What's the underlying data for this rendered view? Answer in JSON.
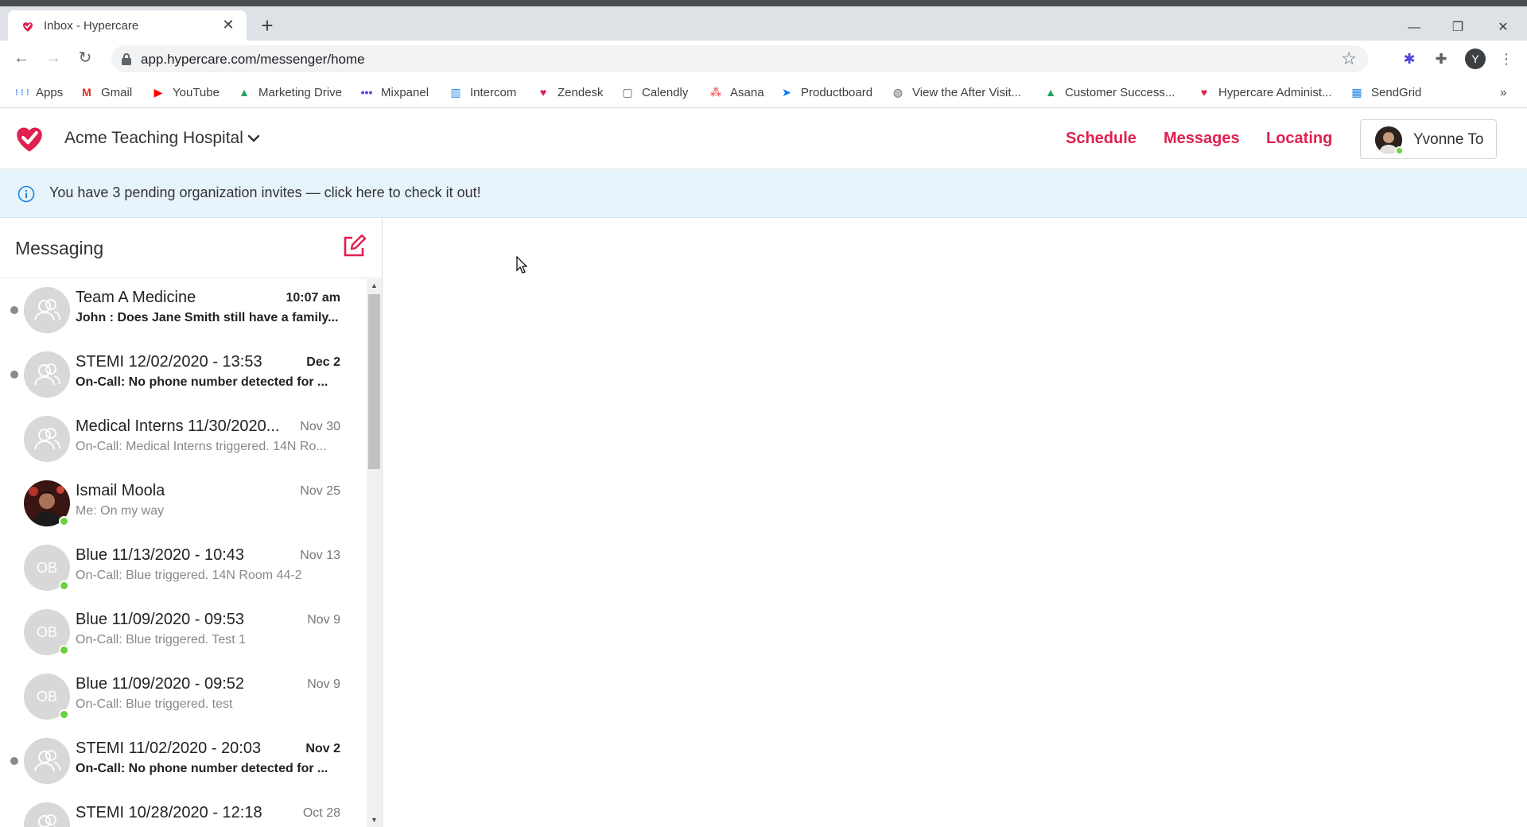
{
  "browser": {
    "tab_title": "Inbox - Hypercare",
    "tab_close": "✕",
    "new_tab": "+",
    "url": "app.hypercare.com/messenger/home",
    "profile_initial": "Y",
    "window_controls": {
      "minimize": "—",
      "restore": "❐",
      "close": "✕"
    },
    "bookmarks": [
      {
        "label": "Apps",
        "icon": "apps-grid-icon",
        "color": "#4285f4"
      },
      {
        "label": "Gmail",
        "icon": "gmail-icon",
        "color": "#d93025"
      },
      {
        "label": "YouTube",
        "icon": "youtube-icon",
        "color": "#ff0000"
      },
      {
        "label": "Marketing Drive",
        "icon": "google-drive-icon",
        "color": "#1fa463"
      },
      {
        "label": "Mixpanel",
        "icon": "mixpanel-icon",
        "color": "#4f44e0"
      },
      {
        "label": "Intercom",
        "icon": "intercom-icon",
        "color": "#1f8ded"
      },
      {
        "label": "Zendesk",
        "icon": "hypercare-heart-icon",
        "color": "#e0204f"
      },
      {
        "label": "Calendly",
        "icon": "calendly-icon",
        "color": "#5f6368"
      },
      {
        "label": "Asana",
        "icon": "asana-icon",
        "color": "#f06a6a"
      },
      {
        "label": "Productboard",
        "icon": "productboard-icon",
        "color": "#0077ff"
      },
      {
        "label": "View the After Visit...",
        "icon": "globe-icon",
        "color": "#5f6368"
      },
      {
        "label": "Customer Success...",
        "icon": "google-drive-icon",
        "color": "#1fa463"
      },
      {
        "label": "Hypercare Administ...",
        "icon": "hypercare-heart-icon",
        "color": "#e0204f"
      },
      {
        "label": "SendGrid",
        "icon": "sendgrid-icon",
        "color": "#1a82e2"
      }
    ],
    "bookmarks_overflow": "»"
  },
  "app": {
    "brand_color": "#e0204f",
    "org_name": "Acme Teaching Hospital",
    "nav": [
      "Schedule",
      "Messages",
      "Locating"
    ],
    "user_name": "Yvonne To",
    "banner_text": "You have 3 pending organization invites — click here to check it out!",
    "sidebar_title": "Messaging",
    "conversations": [
      {
        "name": "Team A Medicine",
        "time": "10:07 am",
        "preview": "John : Does Jane Smith still have a family...",
        "unread": true,
        "avatar": "group",
        "online": false
      },
      {
        "name": "STEMI 12/02/2020 - 13:53",
        "time": "Dec 2",
        "preview": "On-Call: No phone number detected for ...",
        "unread": true,
        "avatar": "group",
        "online": false
      },
      {
        "name": "Medical Interns 11/30/2020...",
        "time": "Nov 30",
        "preview": "On-Call: Medical Interns triggered. 14N Ro...",
        "unread": false,
        "avatar": "group",
        "online": false
      },
      {
        "name": "Ismail Moola",
        "time": "Nov 25",
        "preview": "Me: On my way",
        "unread": false,
        "avatar": "photo",
        "online": true
      },
      {
        "name": "Blue 11/13/2020 - 10:43",
        "time": "Nov 13",
        "preview": "On-Call: Blue triggered. 14N Room 44-2",
        "unread": false,
        "avatar": "OB",
        "online": true
      },
      {
        "name": "Blue 11/09/2020 - 09:53",
        "time": "Nov 9",
        "preview": "On-Call: Blue triggered. Test 1",
        "unread": false,
        "avatar": "OB",
        "online": true
      },
      {
        "name": "Blue 11/09/2020 - 09:52",
        "time": "Nov 9",
        "preview": "On-Call: Blue triggered. test",
        "unread": false,
        "avatar": "OB",
        "online": true
      },
      {
        "name": "STEMI 11/02/2020 - 20:03",
        "time": "Nov 2",
        "preview": "On-Call: No phone number detected for ...",
        "unread": true,
        "avatar": "group",
        "online": false
      },
      {
        "name": "STEMI 10/28/2020 - 12:18",
        "time": "Oct 28",
        "preview": "",
        "unread": false,
        "avatar": "group",
        "online": false
      }
    ]
  }
}
